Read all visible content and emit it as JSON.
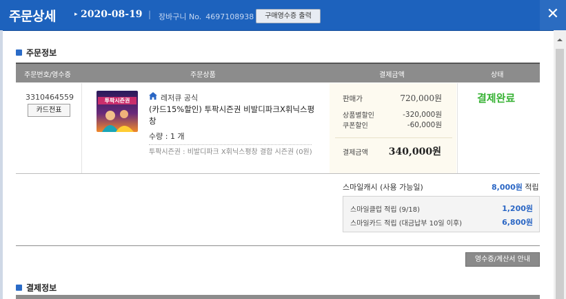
{
  "header": {
    "title": "주문상세",
    "date": "2020-08-19",
    "separator": "|",
    "cart_label": "장바구니 No.",
    "cart_number": "4697108938",
    "receipt_button": "구매영수증 출력",
    "close_label": "✕"
  },
  "order_section": {
    "title": "주문정보"
  },
  "table": {
    "columns": [
      "주문번호/영수증",
      "주문상품",
      "결제금액",
      "상태"
    ]
  },
  "order": {
    "number": "3310464559",
    "card_slip_button": "카드전표",
    "thumbnail_caption": "투팍시즌권",
    "seller": "레저큐 공식",
    "product_name": "(카드15%할인) 투팍시즌권 비발디파크X휘닉스평창",
    "quantity": "수량 : 1 개",
    "option": "투팍시즌권 : 비발디파크 X휘닉스평창 결합 시즌권 (0원)",
    "status": "결제완료"
  },
  "price": {
    "sale_label": "판매가",
    "sale_value": "720,000원",
    "product_discount_label": "상품별할인",
    "product_discount_value": "-320,000원",
    "coupon_discount_label": "쿠폰할인",
    "coupon_discount_value": "-60,000원",
    "payment_label": "결제금액",
    "payment_value": "340,000원"
  },
  "rewards": {
    "smile_cash_label": "스마일캐시 (사용 가능일)",
    "smile_cash_value": "8,000원",
    "smile_cash_suffix": " 적립",
    "smile_club_label": "스마일클럽 적립 (9/18)",
    "smile_club_value": "1,200원",
    "smile_card_label": "스마일카드 적립 (대금납부 10일 이후)",
    "smile_card_value": "6,800원"
  },
  "receipt_guide_button": "영수증/계산서 안내",
  "payment_section": {
    "title": "결제정보"
  },
  "colors": {
    "header_bg": "#1d62bd",
    "status_green": "#37b234",
    "link_blue": "#2a66c4"
  }
}
